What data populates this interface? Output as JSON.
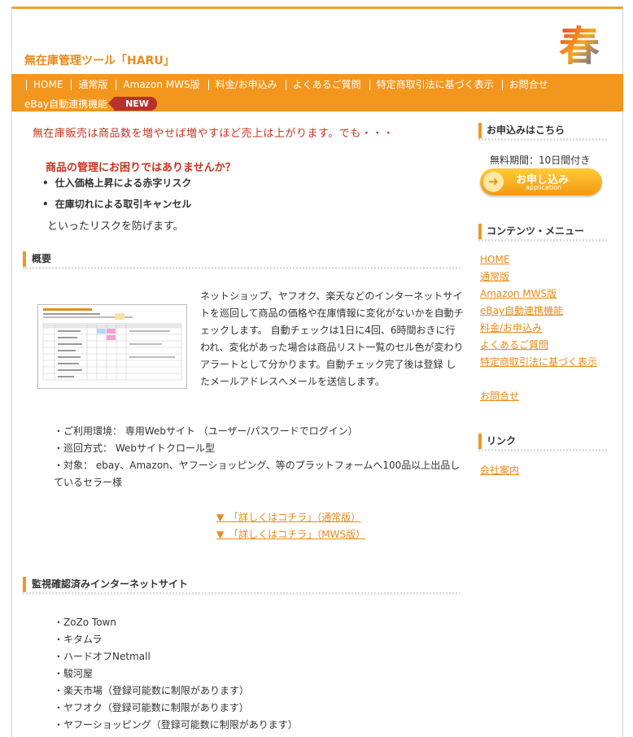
{
  "header": {
    "title": "無在庫管理ツール「HARU」",
    "logo_glyph": "春"
  },
  "nav": {
    "items": [
      "HOME",
      "通常版",
      "Amazon MWS版",
      "料金/お申込み",
      "よくあるご質問",
      "特定商取引法に基づく表示",
      "お問合せ"
    ],
    "ebay_label": "eBay自動連携機能",
    "new_badge": "NEW"
  },
  "intro": {
    "lead": "無在庫販売は商品数を増やせば増やすほど売上は上がります。でも・・・",
    "question": "商品の管理にお困りではありませんか？",
    "risks": [
      "仕入価格上昇による赤字リスク",
      "在庫切れによる取引キャンセル"
    ],
    "conclusion": "といったリスクを防げます。"
  },
  "overview": {
    "heading": "概要",
    "description": "ネットショップ、ヤフオク、楽天などのインターネットサイトを巡回して商品の価格や在庫情報に変化がないかを自動チェックします。 自動チェックは1日に4回、6時間おきに行われ、変化があった場合は商品リスト一覧のセル色が変わりアラートとして分かります。自動チェック完了後は登録 したメールアドレスへメールを送信します。",
    "specs": [
      "・ご利用環境： 専用Webサイト （ユーザー/パスワードでログイン）",
      "・巡回方式： Webサイトクロール型",
      "・対象： ebay、Amazon、ヤフーショッピング、等のプラットフォームへ100品以上出品しているセラー様"
    ],
    "links": [
      "▼　「詳しくはコチラ」（通常版）",
      "▼　「詳しくはコチラ」（MWS版）"
    ]
  },
  "monitored": {
    "heading": "監視確認済みインターネットサイト",
    "sites": [
      "・ZoZo Town",
      "・キタムラ",
      "・ハードオフNetmall",
      "・駿河屋",
      "・楽天市場（登録可能数に制限があります）",
      "・ヤフオク（登録可能数に制限があります）",
      "・ヤフーショッピング（登録可能数に制限があります）"
    ]
  },
  "sidebar": {
    "apply_heading": "お申込みはこちら",
    "trial_text": "無料期間：10日間付き",
    "apply_button": "お申し込み",
    "apply_button_sub": "application",
    "menu_heading": "コンテンツ・メニュー",
    "menu_items": [
      "HOME",
      "通常版",
      "Amazon MWS版",
      "eBay自動連携機能",
      "料金/お申込み",
      "よくあるご質問",
      "特定商取引法に基づく表示",
      "お問合せ"
    ],
    "link_heading": "リンク",
    "link_items": [
      "会社案内"
    ]
  },
  "colors": {
    "accent": "#f3961e",
    "title_orange": "#e88a1a",
    "alert_red": "#c8341f",
    "badge_red": "#b8322a"
  }
}
